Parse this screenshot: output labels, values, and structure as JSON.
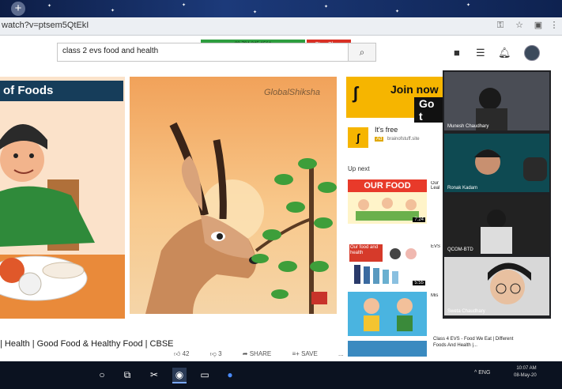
{
  "browser": {
    "url": "watch?v=ptsem5QtEkI",
    "new_tab_label": "+"
  },
  "youtube": {
    "search_value": "class 2 evs food and health",
    "share_banner": "88-794-345-1564",
    "stop_share_label": "Stop Share"
  },
  "main_video": {
    "left_thumb_title": "of Foods",
    "watermark": "GlobalShiksha",
    "title": "| Health | Good Food & Healthy Food | CBSE",
    "likes": "42",
    "dislikes": "3",
    "share_label": "SHARE",
    "save_label": "SAVE",
    "more_label": "..."
  },
  "sidebar": {
    "ad_title": "Join now",
    "ad_subtitle": "Go t",
    "ad_free_text": "It's free",
    "ad_badge": "Ad",
    "ad_domain": "brainofstuff.site",
    "up_next_label": "Up next",
    "videos": [
      {
        "thumb_text": "OUR FOOD",
        "title": "Our Leal",
        "duration": "7:24"
      },
      {
        "thumb_text": "Our food and health",
        "title": "EVS",
        "duration": "5:55"
      },
      {
        "thumb_text": "",
        "title": "Mis",
        "duration": ""
      }
    ],
    "last_title": "Class 4 EVS - Food We Eat | Different Foods And Health |..."
  },
  "meet": {
    "participants": [
      {
        "name": "Munesh Chaudhary"
      },
      {
        "name": "Ronak Kadam"
      },
      {
        "name": "QCOM-BTD"
      },
      {
        "name": "Sweta Chaudhary"
      }
    ]
  },
  "taskbar": {
    "tray_text": "^ ENG",
    "time": "10:07 AM",
    "date": "08-May-20"
  },
  "colors": {
    "accent_ad": "#f6b500",
    "share_green": "#2e9e3f",
    "stop_red": "#d93025"
  }
}
